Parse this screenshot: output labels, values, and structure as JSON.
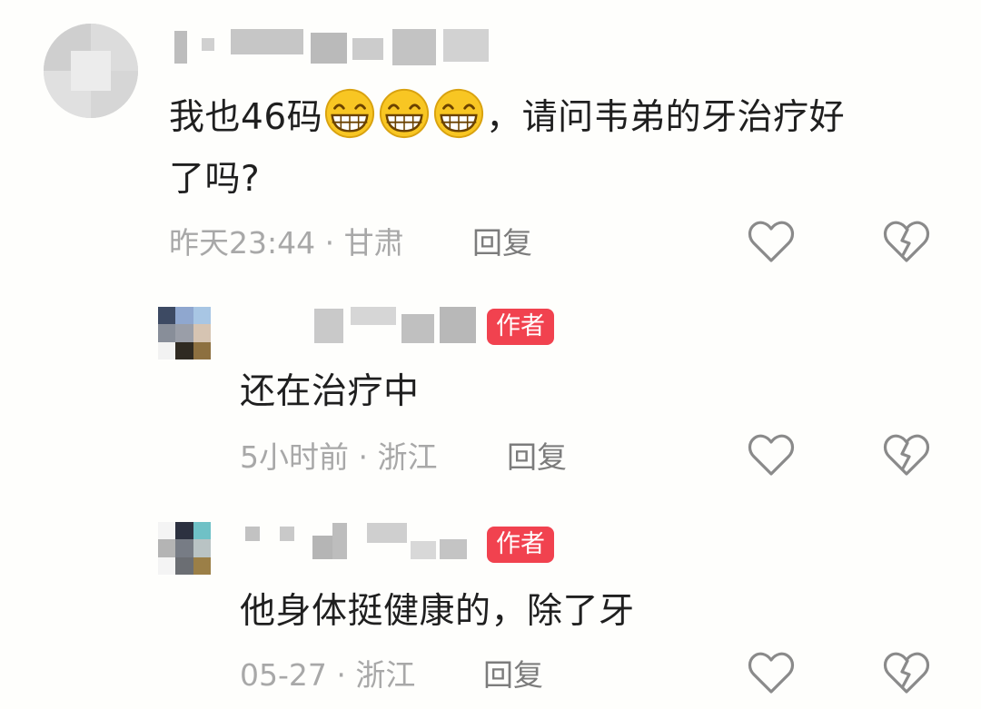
{
  "comments": [
    {
      "text_before_emoji": "我也46码",
      "emoji": [
        "grinning-emoji",
        "grinning-emoji",
        "grinning-emoji"
      ],
      "text_after_emoji": "，请问韦弟的牙治疗好",
      "text_line2": "了吗?",
      "time": "昨天23:44",
      "location": "甘肃",
      "reply_label": "回复"
    },
    {
      "text": "还在治疗中",
      "badge": "作者",
      "time": "5小时前",
      "location": "浙江",
      "reply_label": "回复"
    },
    {
      "text": "他身体挺健康的，除了牙",
      "badge": "作者",
      "time": "05-27",
      "location": "浙江",
      "reply_label": "回复"
    }
  ],
  "meta_separator": "·",
  "colors": {
    "badge": "#f1424f",
    "meta": "#a8a8a8",
    "reply": "#7c7c7c",
    "text": "#1f1f1f",
    "icon": "#8a8a8a"
  },
  "icons": [
    "heart-outline-icon",
    "broken-heart-icon"
  ]
}
